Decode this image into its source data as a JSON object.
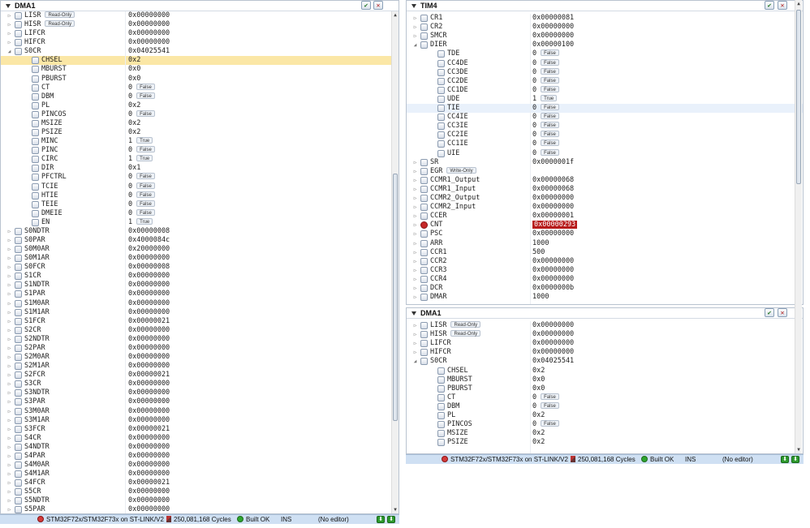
{
  "left": {
    "title": "DMA1",
    "rows": [
      {
        "name": "LISR",
        "value": "0x00000000",
        "badge": "Read-Only",
        "lvl": 0,
        "exp": "▷"
      },
      {
        "name": "HISR",
        "value": "0x00000000",
        "badge": "Read-Only",
        "lvl": 0,
        "exp": "▷"
      },
      {
        "name": "LIFCR",
        "value": "0x00000000",
        "lvl": 0,
        "exp": "▷"
      },
      {
        "name": "HIFCR",
        "value": "0x00000000",
        "lvl": 0,
        "exp": "▷"
      },
      {
        "name": "S0CR",
        "value": "0x04025541",
        "lvl": 0,
        "exp": "◢"
      },
      {
        "name": "CHSEL",
        "value": "0x2",
        "lvl": 1,
        "hl": true
      },
      {
        "name": "MBURST",
        "value": "0x0",
        "lvl": 1
      },
      {
        "name": "PBURST",
        "value": "0x0",
        "lvl": 1
      },
      {
        "name": "CT",
        "value": "0",
        "badge": "False",
        "lvl": 1
      },
      {
        "name": "DBM",
        "value": "0",
        "badge": "False",
        "lvl": 1
      },
      {
        "name": "PL",
        "value": "0x2",
        "lvl": 1
      },
      {
        "name": "PINCOS",
        "value": "0",
        "badge": "False",
        "lvl": 1
      },
      {
        "name": "MSIZE",
        "value": "0x2",
        "lvl": 1
      },
      {
        "name": "PSIZE",
        "value": "0x2",
        "lvl": 1
      },
      {
        "name": "MINC",
        "value": "1",
        "badge": "True",
        "lvl": 1
      },
      {
        "name": "PINC",
        "value": "0",
        "badge": "False",
        "lvl": 1
      },
      {
        "name": "CIRC",
        "value": "1",
        "badge": "True",
        "lvl": 1
      },
      {
        "name": "DIR",
        "value": "0x1",
        "lvl": 1
      },
      {
        "name": "PFCTRL",
        "value": "0",
        "badge": "False",
        "lvl": 1
      },
      {
        "name": "TCIE",
        "value": "0",
        "badge": "False",
        "lvl": 1
      },
      {
        "name": "HTIE",
        "value": "0",
        "badge": "False",
        "lvl": 1
      },
      {
        "name": "TEIE",
        "value": "0",
        "badge": "False",
        "lvl": 1
      },
      {
        "name": "DMEIE",
        "value": "0",
        "badge": "False",
        "lvl": 1
      },
      {
        "name": "EN",
        "value": "1",
        "badge": "True",
        "lvl": 1
      },
      {
        "name": "S0NDTR",
        "value": "0x00000008",
        "lvl": 0,
        "exp": "▷"
      },
      {
        "name": "S0PAR",
        "value": "0x4000084c",
        "lvl": 0,
        "exp": "▷"
      },
      {
        "name": "S0M0AR",
        "value": "0x20000000",
        "lvl": 0,
        "exp": "▷"
      },
      {
        "name": "S0M1AR",
        "value": "0x00000000",
        "lvl": 0,
        "exp": "▷"
      },
      {
        "name": "S0FCR",
        "value": "0x00000008",
        "lvl": 0,
        "exp": "▷"
      },
      {
        "name": "S1CR",
        "value": "0x00000000",
        "lvl": 0,
        "exp": "▷"
      },
      {
        "name": "S1NDTR",
        "value": "0x00000000",
        "lvl": 0,
        "exp": "▷"
      },
      {
        "name": "S1PAR",
        "value": "0x00000000",
        "lvl": 0,
        "exp": "▷"
      },
      {
        "name": "S1M0AR",
        "value": "0x00000000",
        "lvl": 0,
        "exp": "▷"
      },
      {
        "name": "S1M1AR",
        "value": "0x00000000",
        "lvl": 0,
        "exp": "▷"
      },
      {
        "name": "S1FCR",
        "value": "0x00000021",
        "lvl": 0,
        "exp": "▷"
      },
      {
        "name": "S2CR",
        "value": "0x00000000",
        "lvl": 0,
        "exp": "▷"
      },
      {
        "name": "S2NDTR",
        "value": "0x00000000",
        "lvl": 0,
        "exp": "▷"
      },
      {
        "name": "S2PAR",
        "value": "0x00000000",
        "lvl": 0,
        "exp": "▷"
      },
      {
        "name": "S2M0AR",
        "value": "0x00000000",
        "lvl": 0,
        "exp": "▷"
      },
      {
        "name": "S2M1AR",
        "value": "0x00000000",
        "lvl": 0,
        "exp": "▷"
      },
      {
        "name": "S2FCR",
        "value": "0x00000021",
        "lvl": 0,
        "exp": "▷"
      },
      {
        "name": "S3CR",
        "value": "0x00000000",
        "lvl": 0,
        "exp": "▷"
      },
      {
        "name": "S3NDTR",
        "value": "0x00000000",
        "lvl": 0,
        "exp": "▷"
      },
      {
        "name": "S3PAR",
        "value": "0x00000000",
        "lvl": 0,
        "exp": "▷"
      },
      {
        "name": "S3M0AR",
        "value": "0x00000000",
        "lvl": 0,
        "exp": "▷"
      },
      {
        "name": "S3M1AR",
        "value": "0x00000000",
        "lvl": 0,
        "exp": "▷"
      },
      {
        "name": "S3FCR",
        "value": "0x00000021",
        "lvl": 0,
        "exp": "▷"
      },
      {
        "name": "S4CR",
        "value": "0x00000000",
        "lvl": 0,
        "exp": "▷"
      },
      {
        "name": "S4NDTR",
        "value": "0x00000000",
        "lvl": 0,
        "exp": "▷"
      },
      {
        "name": "S4PAR",
        "value": "0x00000000",
        "lvl": 0,
        "exp": "▷"
      },
      {
        "name": "S4M0AR",
        "value": "0x00000000",
        "lvl": 0,
        "exp": "▷"
      },
      {
        "name": "S4M1AR",
        "value": "0x00000000",
        "lvl": 0,
        "exp": "▷"
      },
      {
        "name": "S4FCR",
        "value": "0x00000021",
        "lvl": 0,
        "exp": "▷"
      },
      {
        "name": "S5CR",
        "value": "0x00000000",
        "lvl": 0,
        "exp": "▷"
      },
      {
        "name": "S5NDTR",
        "value": "0x00000000",
        "lvl": 0,
        "exp": "▷"
      },
      {
        "name": "S5PAR",
        "value": "0x00000000",
        "lvl": 0,
        "exp": "▷"
      }
    ]
  },
  "tim4": {
    "title": "TIM4",
    "rows": [
      {
        "name": "CR1",
        "value": "0x00000081",
        "lvl": 0,
        "exp": "▷"
      },
      {
        "name": "CR2",
        "value": "0x00000000",
        "lvl": 0,
        "exp": "▷"
      },
      {
        "name": "SMCR",
        "value": "0x00000000",
        "lvl": 0,
        "exp": "▷"
      },
      {
        "name": "DIER",
        "value": "0x00000100",
        "lvl": 0,
        "exp": "◢"
      },
      {
        "name": "TDE",
        "value": "0",
        "badge": "False",
        "lvl": 1
      },
      {
        "name": "CC4DE",
        "value": "0",
        "badge": "False",
        "lvl": 1
      },
      {
        "name": "CC3DE",
        "value": "0",
        "badge": "False",
        "lvl": 1
      },
      {
        "name": "CC2DE",
        "value": "0",
        "badge": "False",
        "lvl": 1
      },
      {
        "name": "CC1DE",
        "value": "0",
        "badge": "False",
        "lvl": 1
      },
      {
        "name": "UDE",
        "value": "1",
        "badge": "True",
        "lvl": 1
      },
      {
        "name": "TIE",
        "value": "0",
        "badge": "False",
        "lvl": 1,
        "sel": true
      },
      {
        "name": "CC4IE",
        "value": "0",
        "badge": "False",
        "lvl": 1
      },
      {
        "name": "CC3IE",
        "value": "0",
        "badge": "False",
        "lvl": 1
      },
      {
        "name": "CC2IE",
        "value": "0",
        "badge": "False",
        "lvl": 1
      },
      {
        "name": "CC1IE",
        "value": "0",
        "badge": "False",
        "lvl": 1
      },
      {
        "name": "UIE",
        "value": "0",
        "badge": "False",
        "lvl": 1
      },
      {
        "name": "SR",
        "value": "0x0000001f",
        "lvl": 0,
        "exp": "▷"
      },
      {
        "name": "EGR",
        "value": "",
        "badge": "Write-Only",
        "lvl": 0,
        "exp": "▷",
        "badgeOnName": true
      },
      {
        "name": "CCMR1_Output",
        "value": "0x00000068",
        "lvl": 0,
        "exp": "▷"
      },
      {
        "name": "CCMR1_Input",
        "value": "0x00000068",
        "lvl": 0,
        "exp": "▷"
      },
      {
        "name": "CCMR2_Output",
        "value": "0x00000000",
        "lvl": 0,
        "exp": "▷"
      },
      {
        "name": "CCMR2_Input",
        "value": "0x00000000",
        "lvl": 0,
        "exp": "▷"
      },
      {
        "name": "CCER",
        "value": "0x00000001",
        "lvl": 0,
        "exp": "▷"
      },
      {
        "name": "CNT",
        "value": "0x00000293",
        "lvl": 0,
        "exp": "▷",
        "red": true
      },
      {
        "name": "PSC",
        "value": "0x00000000",
        "lvl": 0,
        "exp": "▷"
      },
      {
        "name": "ARR",
        "value": "1000",
        "lvl": 0,
        "exp": "▷"
      },
      {
        "name": "CCR1",
        "value": "500",
        "lvl": 0,
        "exp": "▷"
      },
      {
        "name": "CCR2",
        "value": "0x00000000",
        "lvl": 0,
        "exp": "▷"
      },
      {
        "name": "CCR3",
        "value": "0x00000000",
        "lvl": 0,
        "exp": "▷"
      },
      {
        "name": "CCR4",
        "value": "0x00000000",
        "lvl": 0,
        "exp": "▷"
      },
      {
        "name": "DCR",
        "value": "0x0000000b",
        "lvl": 0,
        "exp": "▷"
      },
      {
        "name": "DMAR",
        "value": "1000",
        "lvl": 0,
        "exp": "▷"
      }
    ]
  },
  "dma2": {
    "title": "DMA1",
    "rows": [
      {
        "name": "LISR",
        "value": "0x00000000",
        "badge": "Read-Only",
        "lvl": 0,
        "exp": "▷"
      },
      {
        "name": "HISR",
        "value": "0x00000000",
        "badge": "Read-Only",
        "lvl": 0,
        "exp": "▷"
      },
      {
        "name": "LIFCR",
        "value": "0x00000000",
        "lvl": 0,
        "exp": "▷"
      },
      {
        "name": "HIFCR",
        "value": "0x00000000",
        "lvl": 0,
        "exp": "▷"
      },
      {
        "name": "S0CR",
        "value": "0x04025541",
        "lvl": 0,
        "exp": "◢"
      },
      {
        "name": "CHSEL",
        "value": "0x2",
        "lvl": 1
      },
      {
        "name": "MBURST",
        "value": "0x0",
        "lvl": 1
      },
      {
        "name": "PBURST",
        "value": "0x0",
        "lvl": 1
      },
      {
        "name": "CT",
        "value": "0",
        "badge": "False",
        "lvl": 1
      },
      {
        "name": "DBM",
        "value": "0",
        "badge": "False",
        "lvl": 1
      },
      {
        "name": "PL",
        "value": "0x2",
        "lvl": 1
      },
      {
        "name": "PINCOS",
        "value": "0",
        "badge": "False",
        "lvl": 1
      },
      {
        "name": "MSIZE",
        "value": "0x2",
        "lvl": 1
      },
      {
        "name": "PSIZE",
        "value": "0x2",
        "lvl": 1
      }
    ]
  },
  "status": {
    "target": "STM32F72x/STM32F73x on ST-LINK/V2",
    "cycles": "250,081,168 Cycles",
    "build": "Built OK",
    "ins": "INS",
    "editor": "(No editor)"
  },
  "colors": {
    "highlight": "#fbe7a6",
    "selected": "#e9f1fb",
    "changed": "#b71c1c",
    "statusbar": "#cfe0f3"
  }
}
